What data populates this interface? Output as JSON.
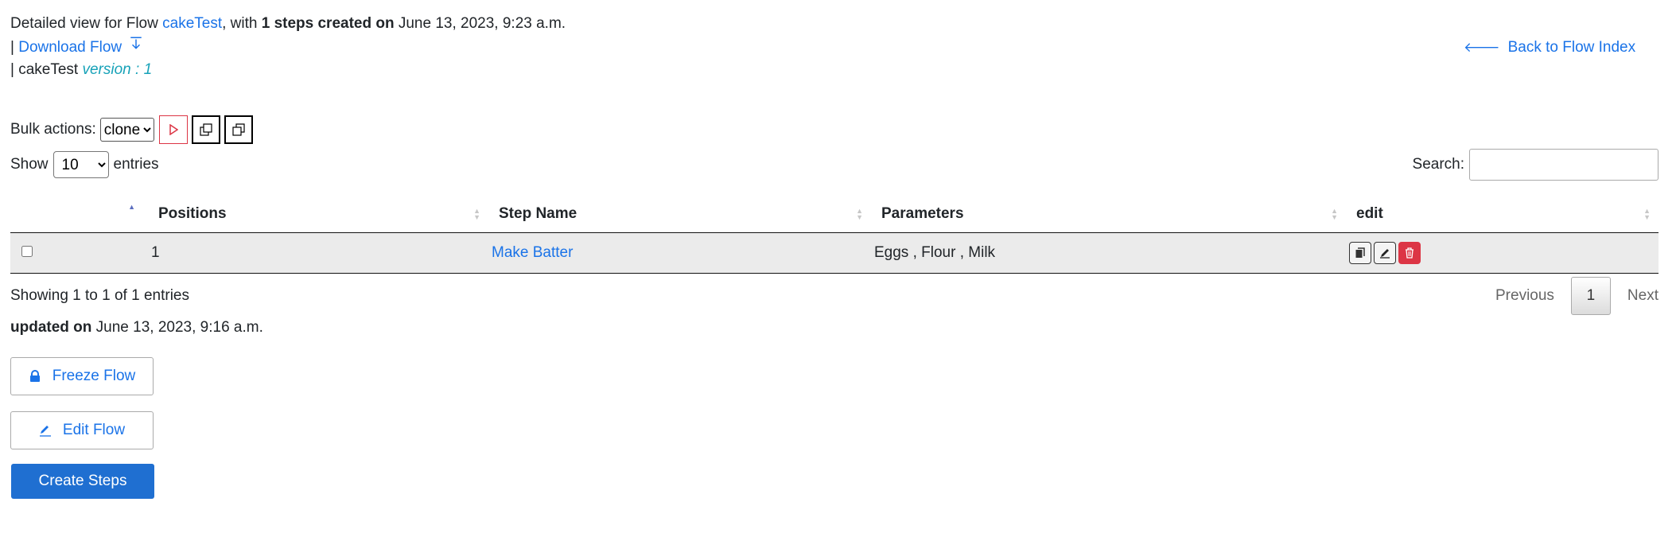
{
  "header": {
    "intro_prefix": "Detailed view for Flow ",
    "flow_name": "cakeTest",
    "intro_mid": ", with ",
    "steps_created": "1 steps created on",
    "created_date": " June 13, 2023, 9:23 a.m.",
    "download_prefix": "| ",
    "download_label": "Download Flow",
    "version_prefix": "| cakeTest ",
    "version_label": "version : 1",
    "back_label": "Back to Flow Index"
  },
  "bulk": {
    "label": "Bulk actions:",
    "selected": "clone"
  },
  "table_controls": {
    "show_label": "Show",
    "show_value": "10",
    "entries_label": "entries",
    "search_label": "Search:"
  },
  "table": {
    "columns": [
      "",
      "Positions",
      "Step Name",
      "Parameters",
      "edit"
    ],
    "rows": [
      {
        "position": "1",
        "step_name": "Make Batter",
        "parameters": "Eggs , Flour , Milk"
      }
    ]
  },
  "footer": {
    "showing": "Showing 1 to 1 of 1 entries",
    "prev": "Previous",
    "page": "1",
    "next": "Next",
    "updated_label": "updated on",
    "updated_date": " June 13, 2023, 9:16 a.m."
  },
  "actions": {
    "freeze": "Freeze Flow",
    "edit": "Edit Flow",
    "create": "Create Steps"
  },
  "colors": {
    "link": "#1a73e8",
    "danger": "#dc3545",
    "primary": "#1f6fd1"
  }
}
